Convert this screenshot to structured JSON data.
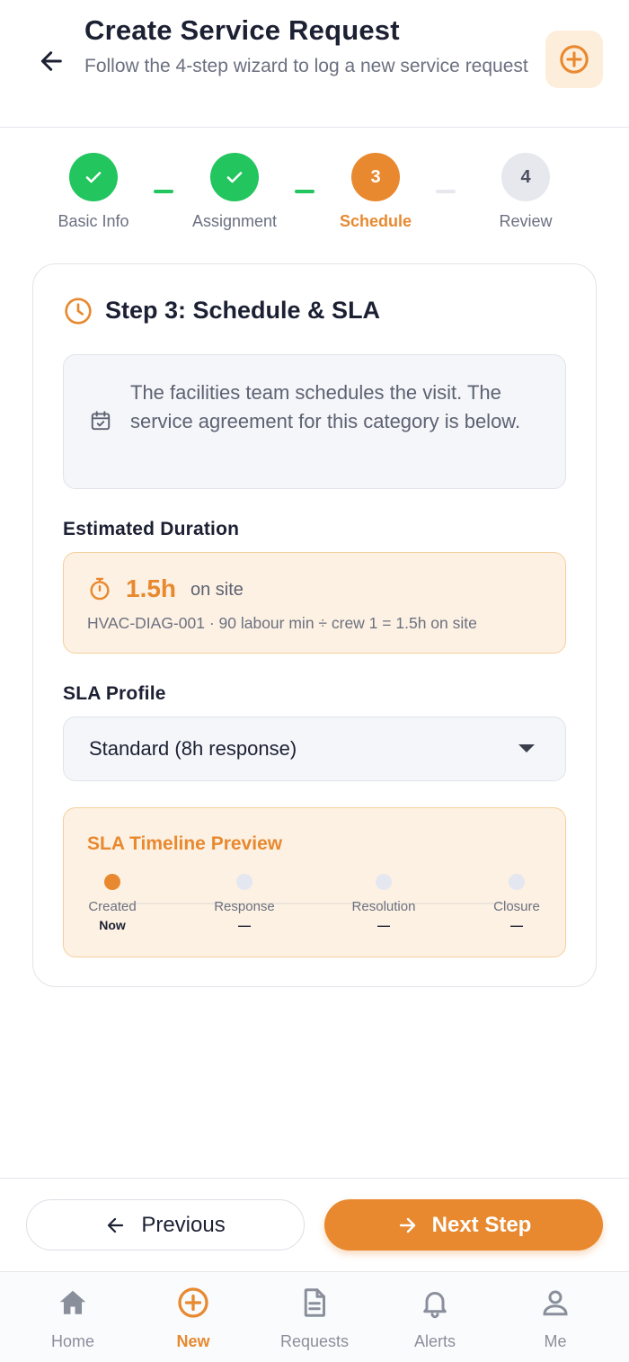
{
  "header": {
    "title": "Create Service Request",
    "subtitle": "Follow the 4-step wizard to log a new service request",
    "back_icon": "arrow-left-icon",
    "action_icon": "plus-circle-icon"
  },
  "stepper": {
    "steps": [
      {
        "number": "1",
        "label": "Basic Info",
        "state": "done"
      },
      {
        "number": "2",
        "label": "Assignment",
        "state": "done"
      },
      {
        "number": "3",
        "label": "Schedule",
        "state": "active"
      },
      {
        "number": "4",
        "label": "Review",
        "state": "todo"
      }
    ]
  },
  "card": {
    "title": "Step 3: Schedule & SLA",
    "info": "The facilities team schedules the visit. The service agreement for this category is below.",
    "duration": {
      "label": "Estimated Duration",
      "value": "1.5h",
      "unit": "on site",
      "formula": "HVAC-DIAG-001 · 90 labour min ÷ crew 1 = 1.5h on site"
    },
    "sla": {
      "label": "SLA Profile",
      "selected": "Standard (8h response)"
    },
    "timeline": {
      "title": "SLA Timeline Preview",
      "items": [
        {
          "name": "Created",
          "value": "Now",
          "active": true
        },
        {
          "name": "Response",
          "value": "—",
          "active": false
        },
        {
          "name": "Resolution",
          "value": "—",
          "active": false
        },
        {
          "name": "Closure",
          "value": "—",
          "active": false
        }
      ]
    }
  },
  "actions": {
    "previous_label": "Previous",
    "next_label": "Next Step"
  },
  "nav": {
    "items": [
      {
        "label": "Home",
        "icon": "home-icon",
        "active": false
      },
      {
        "label": "New",
        "icon": "plus-circle-icon",
        "active": true
      },
      {
        "label": "Requests",
        "icon": "document-icon",
        "active": false
      },
      {
        "label": "Alerts",
        "icon": "bell-icon",
        "active": false
      },
      {
        "label": "Me",
        "icon": "user-icon",
        "active": false
      }
    ]
  },
  "colors": {
    "accent": "#e8892f",
    "success": "#22c55e",
    "muted": "#6b7080"
  }
}
